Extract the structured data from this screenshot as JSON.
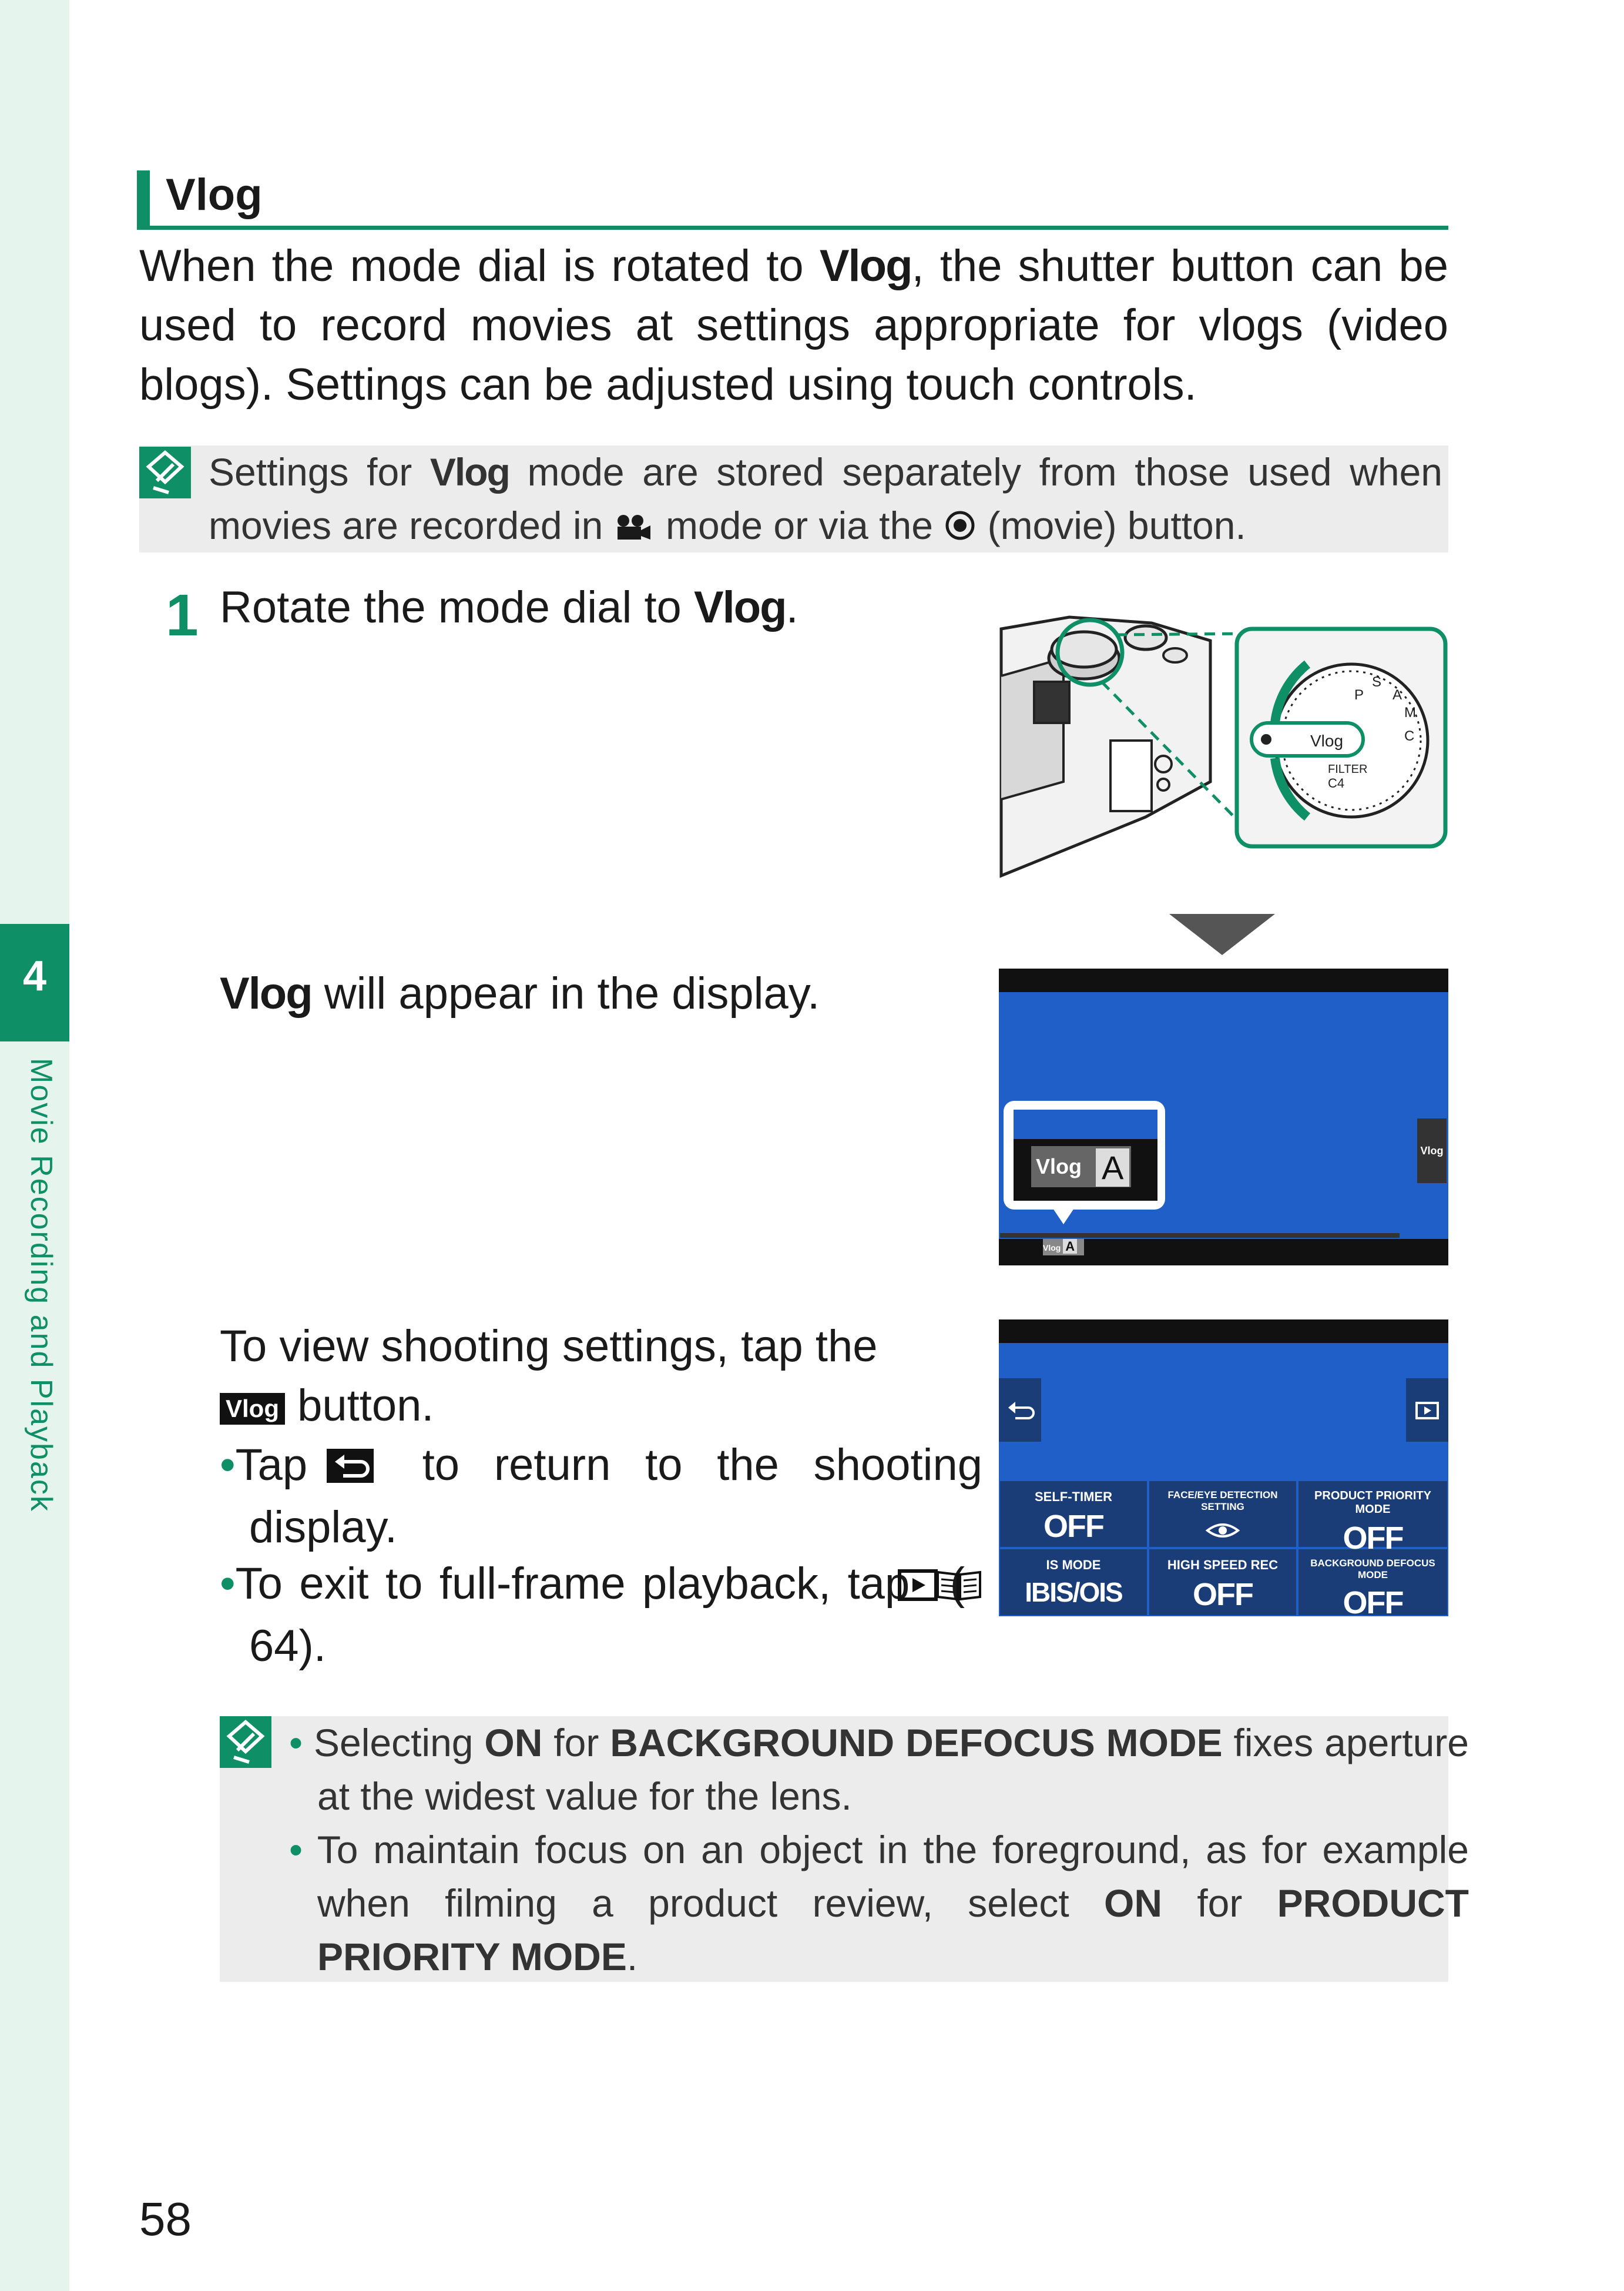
{
  "side_tab": {
    "chapter_number": "4",
    "chapter_label": "Movie Recording and Playback"
  },
  "header": {
    "title": "Vlog"
  },
  "intro": {
    "part1": "When the mode dial is rotated to ",
    "vlog": "Vlog",
    "part2": ", the shutter button can be used to record movies at settings appropriate for vlogs (video blogs). Settings can be adjusted using touch controls."
  },
  "note1": {
    "part1": "Settings for ",
    "vlog": "Vlog",
    "part2": " mode are stored separately from those used when movies are recorded in ",
    "part3": " mode or via the ",
    "part4": " (movie) button."
  },
  "step1": {
    "number": "1",
    "part1": "Rotate the mode dial to ",
    "vlog": "Vlog",
    "part2": "."
  },
  "appear": {
    "vlog": "Vlog",
    "text": " will appear in the display."
  },
  "view": {
    "line": "To view shooting settings, tap the",
    "button_label": "Vlog",
    "button_word": " button.",
    "bullet1_a": "Tap",
    "bullet1_b": "to return to the shooting display.",
    "bullet2_a": "To exit to full-frame playback, tap",
    "bullet2_b": "64)."
  },
  "note2": {
    "b1_part1": "Selecting ",
    "b1_on": "ON",
    "b1_part2": " for ",
    "b1_mode": "BACKGROUND DEFOCUS MODE",
    "b1_part3": " fixes aperture at the widest value for the lens.",
    "b2_part1": "To maintain focus on an object in the foreground, as for example when filming a product review, select ",
    "b2_on": "ON",
    "b2_part2": " for ",
    "b2_mode": "PRODUCT PRIORITY MODE",
    "b2_part3": "."
  },
  "dial": {
    "labels": [
      "Vlog",
      "FILTER",
      "C4",
      "P",
      "S",
      "A",
      "M",
      "C"
    ]
  },
  "display_screen": {
    "vlog_badge": "Vlog",
    "mode_letter": "A",
    "side_button": "Vlog",
    "small_badge": "Vlog",
    "small_letter": "A"
  },
  "settings_screen": {
    "tiles": [
      {
        "title": "SELF-TIMER",
        "value": "OFF"
      },
      {
        "title": "FACE/EYE DETECTION SETTING",
        "value": ""
      },
      {
        "title": "PRODUCT PRIORITY MODE",
        "value": "OFF"
      },
      {
        "title": "IS MODE",
        "value": "IBIS/OIS"
      },
      {
        "title": "HIGH SPEED REC",
        "value": "OFF"
      },
      {
        "title": "BACKGROUND DEFOCUS MODE",
        "value": "OFF"
      }
    ]
  },
  "page_number": "58",
  "colors": {
    "accent": "#0f8f66",
    "screen_blue": "#1f5fc7",
    "tile_blue": "#1a3d78"
  }
}
